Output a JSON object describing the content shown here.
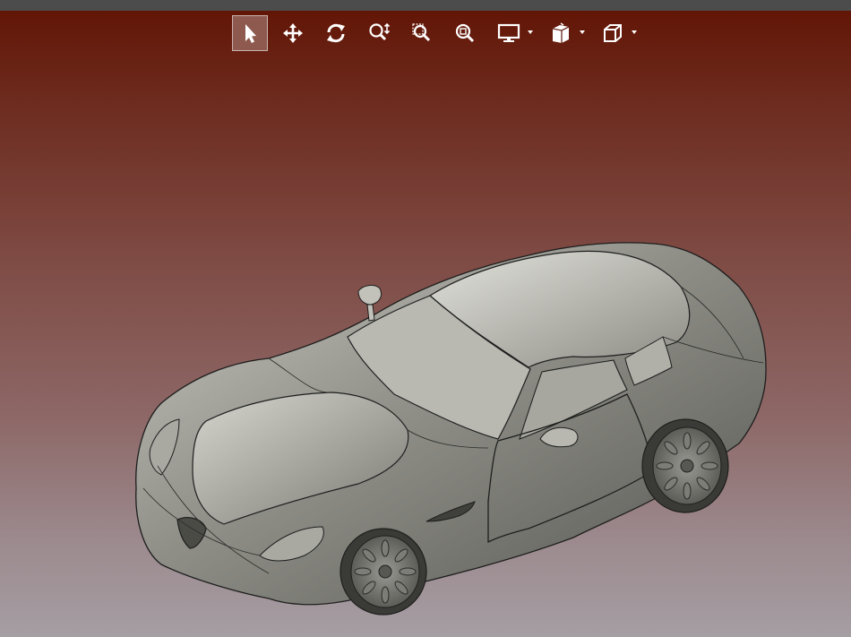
{
  "toolbar": {
    "tools": [
      {
        "name": "select",
        "icon": "select-arrow-icon",
        "active": true
      },
      {
        "name": "pan",
        "icon": "pan-move-icon",
        "active": false
      },
      {
        "name": "rotate",
        "icon": "rotate-icon",
        "active": false
      },
      {
        "name": "zoom",
        "icon": "zoom-icon",
        "active": false
      },
      {
        "name": "zoom-window",
        "icon": "zoom-window-icon",
        "active": false
      },
      {
        "name": "zoom-fit",
        "icon": "zoom-fit-icon",
        "active": false
      },
      {
        "name": "display-mode",
        "icon": "monitor-icon",
        "active": false,
        "dropdown": true
      },
      {
        "name": "view-orientation",
        "icon": "view-cube-icon",
        "active": false,
        "dropdown": true
      },
      {
        "name": "projection",
        "icon": "wireframe-cube-icon",
        "active": false,
        "dropdown": true
      }
    ]
  },
  "viewport": {
    "background_top": "#611303",
    "background_bottom": "#a59ea3",
    "model": "car-3d-model"
  }
}
